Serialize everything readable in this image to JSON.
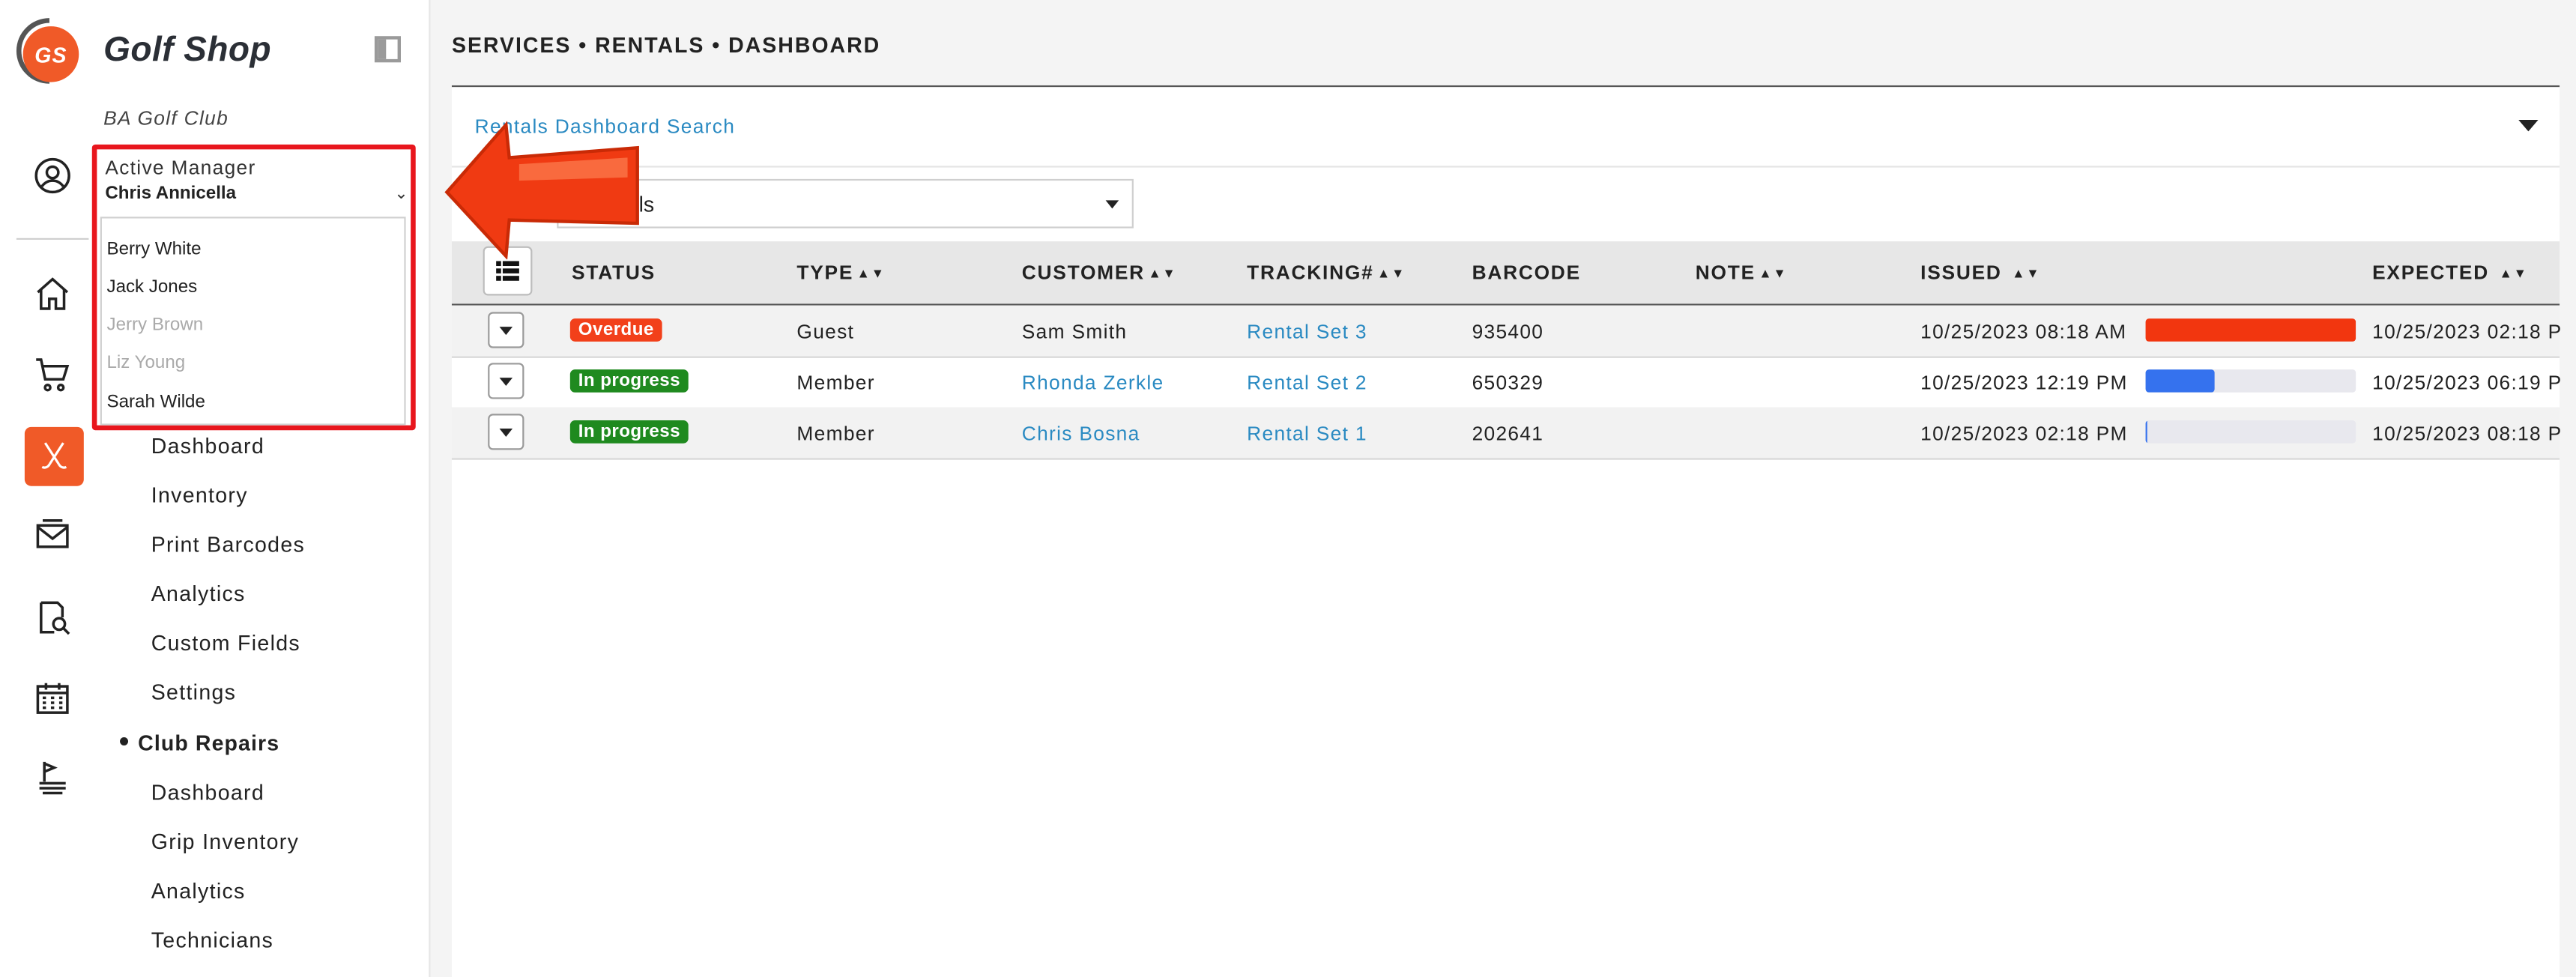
{
  "sidebar": {
    "logo_text": "GS",
    "brand": "Golf Shop",
    "club_name": "BA Golf Club",
    "manager": {
      "label": "Active Manager",
      "value": "Chris Annicella",
      "options": [
        {
          "name": "Berry White",
          "disabled": false
        },
        {
          "name": "Jack Jones",
          "disabled": false
        },
        {
          "name": "Jerry Brown",
          "disabled": true
        },
        {
          "name": "Liz Young",
          "disabled": true
        },
        {
          "name": "Sarah Wilde",
          "disabled": false
        }
      ]
    },
    "rail_icons": [
      "user-circle-icon",
      "home-icon",
      "cart-icon",
      "golf-clubs-icon",
      "mail-icon",
      "document-search-icon",
      "calendar-icon",
      "flag-list-icon"
    ],
    "rentals_items": [
      "Dashboard",
      "Inventory",
      "Print Barcodes",
      "Analytics",
      "Custom Fields",
      "Settings"
    ],
    "club_repairs": {
      "title": "Club Repairs",
      "items": [
        "Dashboard",
        "Grip Inventory",
        "Analytics",
        "Technicians"
      ]
    }
  },
  "main": {
    "breadcrumb": "SERVICES • RENTALS • DASHBOARD",
    "search_title": "Rentals Dashboard Search",
    "filter_value": "t rentals",
    "columns": [
      "STATUS",
      "TYPE",
      "CUSTOMER",
      "TRACKING#",
      "BARCODE",
      "NOTE",
      "ISSUED",
      "EXPECTED"
    ],
    "rows": [
      {
        "status": "Overdue",
        "status_color": "#f2401a",
        "type": "Guest",
        "customer": "Sam Smith",
        "customer_link": false,
        "tracking": "Rental Set 3",
        "barcode": "935400",
        "note": "",
        "issued": "10/25/2023 08:18 AM",
        "progress": 1.0,
        "progress_color": "#f2360f",
        "expected": "10/25/2023 02:18 P"
      },
      {
        "status": "In progress",
        "status_color": "#1f8a1f",
        "type": "Member",
        "customer": "Rhonda Zerkle",
        "customer_link": true,
        "tracking": "Rental Set 2",
        "barcode": "650329",
        "note": "",
        "issued": "10/25/2023 12:19 PM",
        "progress": 0.33,
        "progress_color": "#3572ee",
        "expected": "10/25/2023 06:19 P"
      },
      {
        "status": "In progress",
        "status_color": "#1f8a1f",
        "type": "Member",
        "customer": "Chris Bosna",
        "customer_link": true,
        "tracking": "Rental Set 1",
        "barcode": "202641",
        "note": "",
        "issued": "10/25/2023 02:18 PM",
        "progress": 0.01,
        "progress_color": "#3572ee",
        "expected": "10/25/2023 08:18 P"
      }
    ]
  },
  "colors": {
    "accent": "#f05a28",
    "link": "#2a8ac2",
    "highlight_border": "#e8161d"
  }
}
